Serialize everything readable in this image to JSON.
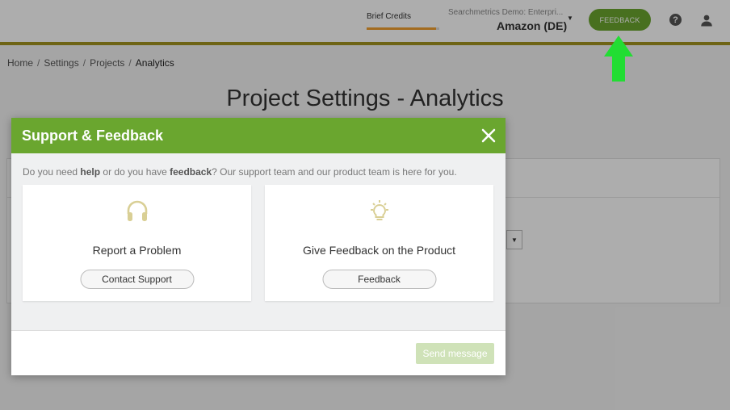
{
  "header": {
    "brief_credits_label": "Brief Credits",
    "credits_progress": 0.95,
    "account_org": "Searchmetrics Demo: Enterpri...",
    "account_project": "Amazon (DE)",
    "feedback_button": "FEEDBACK",
    "help_icon": "?",
    "icons": [
      "help-icon",
      "user-icon",
      "caret-down-icon"
    ],
    "accent_color": "#6aa62f",
    "line_color": "#a3941f"
  },
  "breadcrumb": {
    "items": [
      "Home",
      "Settings",
      "Projects"
    ],
    "current": "Analytics",
    "separator": "/"
  },
  "page": {
    "title": "Project Settings - Analytics"
  },
  "modal": {
    "title": "Support & Feedback",
    "intro_prefix": "Do you need ",
    "intro_help": "help",
    "intro_mid": " or do you have ",
    "intro_feedback": "feedback",
    "intro_suffix": "? Our support team and our product team is here for you.",
    "cards": [
      {
        "icon": "headphones-icon",
        "title": "Report a Problem",
        "button": "Contact Support"
      },
      {
        "icon": "lightbulb-icon",
        "title": "Give Feedback on the Product",
        "button": "Feedback"
      }
    ],
    "send_button": "Send message",
    "send_enabled": false,
    "header_color": "#6aa62f"
  },
  "annotation": {
    "arrow_color": "#22dd33",
    "arrow_icon": "arrow-up-icon"
  }
}
